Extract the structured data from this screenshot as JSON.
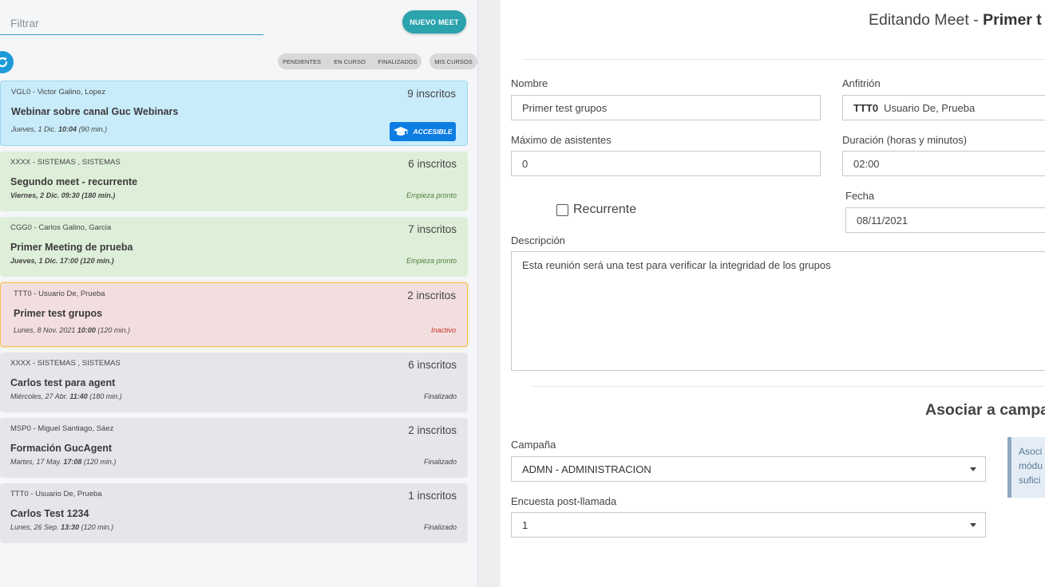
{
  "filter": {
    "placeholder": "Filtrar"
  },
  "toolbar": {
    "new_meet_label": "NUEVO MEET",
    "pills": [
      "PENDIENTES",
      "EN CURSO",
      "FINALIZADOS"
    ],
    "mis_cursos_label": "MIS CURSOS"
  },
  "meets": [
    {
      "owner": "VGL0 - Victor Galino, Lopez",
      "count": "9 inscritos",
      "title": "Webinar sobre canal Guc Webinars",
      "date_prefix": "Jueves, 1 Dic. ",
      "time": "10:04",
      "duration": " (90 min.)",
      "badge": "ACCESIBLE",
      "state": "blue"
    },
    {
      "owner": "XXXX - SISTEMAS , SISTEMAS",
      "count": "6 inscritos",
      "title": "Segundo meet - recurrente",
      "date_full": "Viernes, 2 Dic. 09:30 (180 min.)",
      "status": "Empieza pronto",
      "state": "green"
    },
    {
      "owner": "CGG0 - Carlos Galino, Garcia",
      "count": "7 inscritos",
      "title": "Primer Meeting de prueba",
      "date_full": "Jueves, 1 Dic. 17:00 (120 min.)",
      "status": "Empieza pronto",
      "state": "green"
    },
    {
      "owner": "TTT0 - Usuario De, Prueba",
      "count": "2 inscritos",
      "title": "Primer test grupos",
      "date_prefix": "Lunes, 8 Nov. 2021 ",
      "time": "10:00",
      "duration": " (120 min.)",
      "status": "Inactivo",
      "state": "red"
    },
    {
      "owner": "XXXX - SISTEMAS , SISTEMAS",
      "count": "6 inscritos",
      "title": "Carlos test para agent",
      "date_prefix": "Miércoles, 27 Abr. ",
      "time": "11:40",
      "duration": " (180 min.)",
      "status": "Finalizado",
      "state": "gray"
    },
    {
      "owner": "MSP0 - Miguel Santiago, Sáez",
      "count": "2 inscritos",
      "title": "Formación GucAgent",
      "date_prefix": "Martes, 17 May. ",
      "time": "17:08",
      "duration": " (120 min.)",
      "status": "Finalizado",
      "state": "gray"
    },
    {
      "owner": "TTT0 - Usuario De, Prueba",
      "count": "1 inscritos",
      "title": "Carlos Test 1234",
      "date_prefix": "Lunes, 26 Sep. ",
      "time": "13:30",
      "duration": " (120 min.)",
      "status": "Finalizado",
      "state": "gray"
    }
  ],
  "editor": {
    "heading_prefix": "Editando Meet - ",
    "heading_name": "Primer t",
    "nombre_label": "Nombre",
    "nombre_value": "Primer test grupos",
    "anfitrion_label": "Anfitrión",
    "anfitrion_code": "TTT0",
    "anfitrion_name": "Usuario De, Prueba",
    "max_label": "Máximo de asistentes",
    "max_value": "0",
    "duracion_label": "Duración (horas y minutos)",
    "duracion_value": "02:00",
    "recurrente_label": "Recurrente",
    "fecha_label": "Fecha",
    "fecha_value": "08/11/2021",
    "descripcion_label": "Descripción",
    "descripcion_value": "Esta reunión será una test para verificar la integridad de los grupos",
    "asociar_title": "Asociar a campa",
    "campana_label": "Campaña",
    "campana_value": "ADMN - ADMINISTRACION",
    "encuesta_label": "Encuesta post-llamada",
    "encuesta_value": "1",
    "info_lines": [
      "Asoci",
      "módu",
      "sufici"
    ]
  },
  "colors": {
    "accent": "#2aa3ad",
    "refresh": "#1d9bd8",
    "badge": "#0d7de3"
  }
}
